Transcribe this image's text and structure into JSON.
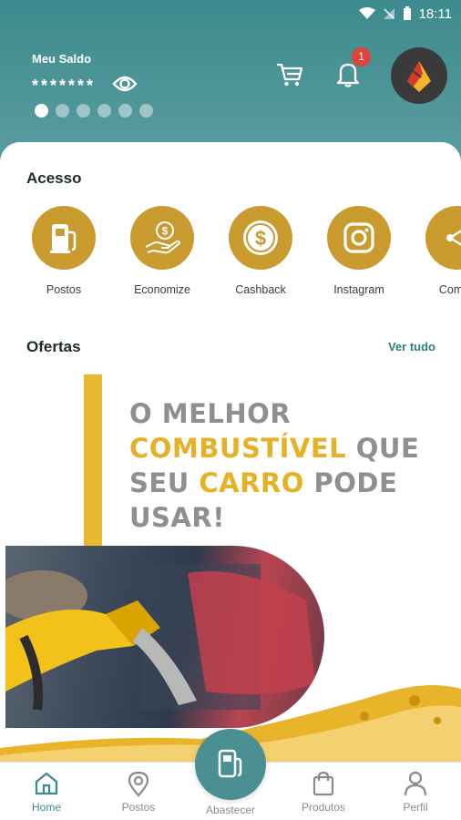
{
  "status_bar": {
    "time": "18:11"
  },
  "header": {
    "balance_label": "Meu Saldo",
    "balance_value": "*******",
    "notification_count": "1",
    "carousel_dots": 6
  },
  "acesso": {
    "title": "Acesso",
    "items": [
      {
        "label": "Postos",
        "icon": "fuel-pump-icon"
      },
      {
        "label": "Economize",
        "icon": "money-hand-icon"
      },
      {
        "label": "Cashback",
        "icon": "dollar-coin-icon"
      },
      {
        "label": "Instagram",
        "icon": "instagram-icon"
      },
      {
        "label": "Compa",
        "icon": "share-icon"
      }
    ]
  },
  "ofertas": {
    "title": "Ofertas",
    "see_all": "Ver tudo",
    "banner": {
      "line1": "O MELHOR",
      "line2_highlight": "COMBUSTÍVEL",
      "line2_rest": " QUE",
      "line3_start": "SEU ",
      "line3_highlight": "CARRO",
      "line3_rest": " PODE",
      "line4": "USAR!"
    }
  },
  "bottom_nav": {
    "home": "Home",
    "postos": "Postos",
    "abastecer": "Abastecer",
    "produtos": "Produtos",
    "perfil": "Perfil"
  },
  "colors": {
    "teal": "#3d8b8e",
    "gold": "#c99a2e",
    "highlight": "#e5b126",
    "badge": "#e0433c"
  }
}
